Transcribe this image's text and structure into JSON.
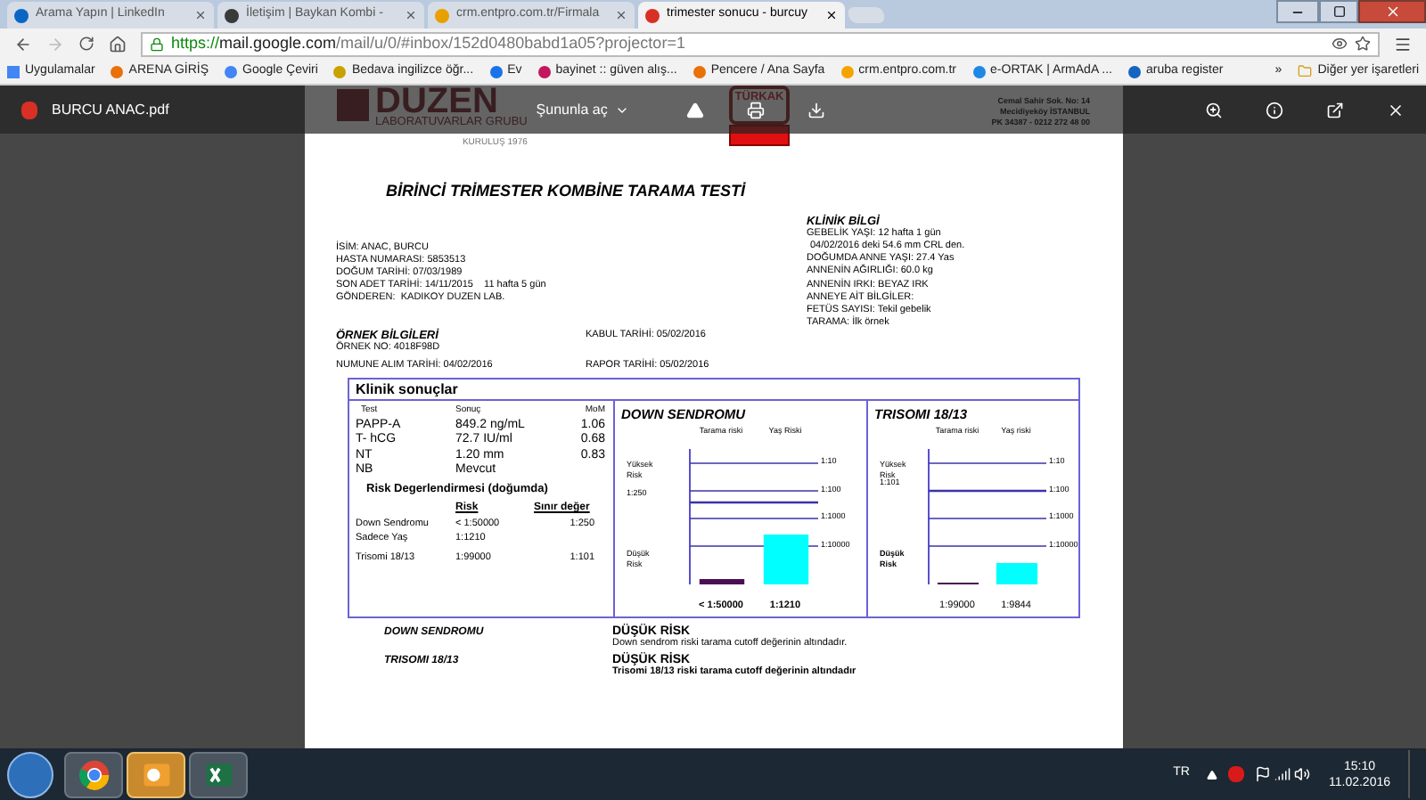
{
  "browser": {
    "tabs": [
      {
        "title": "Arama Yapın | LinkedIn",
        "selected": false
      },
      {
        "title": "İletişim | Baykan Kombi -",
        "selected": false
      },
      {
        "title": "crm.entpro.com.tr/Firmala",
        "selected": false
      },
      {
        "title": "trimester sonucu - burcuy",
        "selected": true
      }
    ],
    "url": {
      "scheme": "https://",
      "host": "mail.google.com",
      "path": "/mail/u/0/#inbox/152d0480babd1a05?projector=1"
    },
    "bookmarks": [
      "Uygulamalar",
      "ARENA GİRİŞ",
      "Google Çeviri",
      "Bedava ingilizce öğr...",
      "Ev",
      "bayinet :: güven alış...",
      "Pencere / Ana Sayfa",
      "crm.entpro.com.tr",
      "e-ORTAK | ArmAdA ...",
      "aruba register"
    ],
    "bookmarks_more": "»",
    "other_bookmarks": "Diğer yer işaretleri"
  },
  "viewer": {
    "file_name": "BURCU ANAC.pdf",
    "open_with": "Şununla aç"
  },
  "letterhead": {
    "logo": "DUZEN",
    "subtitle": "LABORATUVARLAR GRUBU",
    "founded": "KURULUŞ 1976",
    "accreditation": "TÜRKAK",
    "address": [
      "Cemal Sahir Sok. No: 14",
      "Mecidiyeköy İSTANBUL",
      "PK 34387 - 0212 272 48 00"
    ]
  },
  "report": {
    "title": "BİRİNCİ TRİMESTER KOMBİNE TARAMA TESTİ",
    "patient": [
      "İSİM: ANAC, BURCU",
      "HASTA NUMARASI: 5853513",
      "DOĞUM TARİHİ: 07/03/1989",
      "SON ADET TARİHİ: 14/11/2015    11 hafta 5 gün",
      "GÖNDEREN:  KADIKOY DUZEN LAB."
    ],
    "clinical_title": "KLİNİK BİLGİ",
    "clinical": [
      "GEBELİK YAŞI: 12 hafta 1 gün",
      "04/02/2016 deki 54.6 mm CRL den.",
      "DOĞUMDA ANNE YAŞI: 27.4 Yas",
      "ANNENİN AĞIRLIĞI: 60.0 kg",
      "ANNENİN IRKI: BEYAZ IRK",
      "ANNEYE AİT BİLGİLER:",
      "FETÜS SAYISI: Tekil gebelik",
      "TARAMA: İlk örnek"
    ],
    "sample_title": "ÖRNEK BİLGİLERİ",
    "sample_no": "ÖRNEK NO: 4018F98D",
    "sample_date": "NUMUNE ALIM TARİHİ: 04/02/2016",
    "accept_date": "KABUL TARİHİ: 05/02/2016",
    "report_date": "RAPOR TARİHİ: 05/02/2016"
  },
  "results": {
    "title": "Klinik sonuçlar",
    "columns": [
      "Test",
      "Sonuç",
      "MoM"
    ],
    "rows": [
      [
        "PAPP-A",
        "849.2 ng/mL",
        "1.06"
      ],
      [
        "T- hCG",
        "72.7 IU/ml",
        "0.68"
      ],
      [
        "NT",
        "1.20 mm",
        "0.83"
      ],
      [
        "NB",
        "Mevcut"
      ]
    ],
    "risk_title": "Risk Degerlendirmesi  (doğumda)",
    "risk_columns": [
      "Risk",
      "Sınır değer"
    ],
    "risk_rows": [
      [
        "Down Sendromu",
        "< 1:50000",
        "1:250"
      ],
      [
        "Sadece Yaş",
        "1:1210"
      ],
      [
        "Trisomi 18/13",
        "1:99000",
        "1:101"
      ]
    ]
  },
  "charts": [
    {
      "title": "DOWN SENDROMU",
      "high_label": "Yüksek Risk",
      "low_label": "Düşük Risk",
      "cutoff_label": "1:250",
      "tick_labels": [
        "1:10",
        "1:100",
        "1:1000",
        "1:10000"
      ],
      "bars": [
        {
          "header": "Tarama riski",
          "label": "< 1:50000"
        },
        {
          "header": "Yaş Riski",
          "label": "1:1210"
        }
      ]
    },
    {
      "title": "TRISOMI 18/13",
      "high_label": "Yüksek Risk",
      "low_label": "Düşük Risk",
      "cutoff_label": "1:101",
      "tick_labels": [
        "1:10",
        "1:100",
        "1:1000",
        "1:10000"
      ],
      "bars": [
        {
          "header": "Tarama riski",
          "label": "1:99000"
        },
        {
          "header": "Yaş riski",
          "label": "1:9844"
        }
      ]
    }
  ],
  "conclusions": [
    {
      "label": "DOWN SENDROMU",
      "result": "DÜŞÜK RİSK",
      "text": "Down sendrom riski tarama cutoff değerinin altındadır.",
      "bold": false
    },
    {
      "label": "TRISOMI 18/13",
      "result": "DÜŞÜK RİSK",
      "text": "Trisomi 18/13 riski tarama cutoff değerinin altındadır",
      "bold": true
    }
  ],
  "taskbar": {
    "apps": [
      {
        "kind": "chrome",
        "selected": false
      },
      {
        "kind": "outlook",
        "selected": true
      },
      {
        "kind": "excel",
        "selected": false
      }
    ],
    "language": "TR",
    "time": "15:10",
    "date": "11.02.2016"
  }
}
